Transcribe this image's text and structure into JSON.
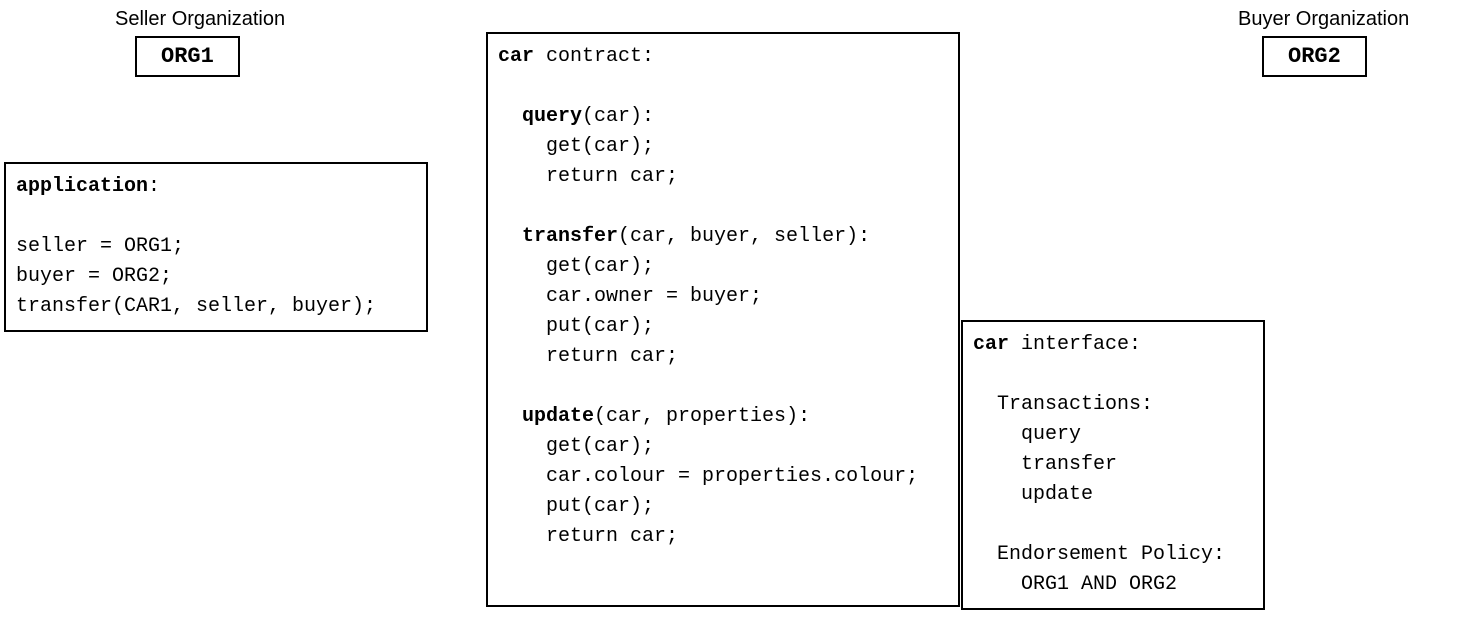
{
  "seller": {
    "label": "Seller Organization",
    "org": "ORG1"
  },
  "buyer": {
    "label": "Buyer Organization",
    "org": "ORG2"
  },
  "application": {
    "title": "application",
    "line1": "seller = ORG1;",
    "line2": "buyer = ORG2;",
    "line3": "transfer(CAR1, seller, buyer);"
  },
  "contract": {
    "title_bold": "car",
    "title_rest": " contract:",
    "query": {
      "name": "query",
      "sig": "(car):",
      "b1": "get(car);",
      "b2": "return car;"
    },
    "transfer": {
      "name": "transfer",
      "sig": "(car, buyer, seller):",
      "b1": "get(car);",
      "b2": "car.owner = buyer;",
      "b3": "put(car);",
      "b4": "return car;"
    },
    "update": {
      "name": "update",
      "sig": "(car, properties):",
      "b1": "get(car);",
      "b2": "car.colour = properties.colour;",
      "b3": "put(car);",
      "b4": "return car;"
    }
  },
  "interface": {
    "title_bold": "car",
    "title_rest": " interface:",
    "tx_header": "Transactions:",
    "tx1": "query",
    "tx2": "transfer",
    "tx3": "update",
    "ep_header": "Endorsement Policy:",
    "ep_body": "ORG1 AND ORG2"
  }
}
